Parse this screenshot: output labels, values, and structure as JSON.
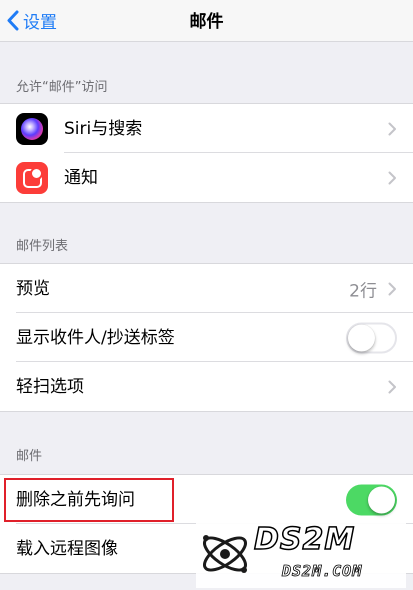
{
  "nav": {
    "back_label": "设置",
    "title": "邮件"
  },
  "sections": {
    "access": {
      "header": "允许“邮件”访问",
      "items": [
        {
          "label": "Siri与搜索",
          "icon": "siri-icon"
        },
        {
          "label": "通知",
          "icon": "notifications-icon"
        }
      ]
    },
    "list": {
      "header": "邮件列表",
      "items": [
        {
          "label": "预览",
          "value": "2行"
        },
        {
          "label": "显示收件人/抄送标签",
          "toggle": false
        },
        {
          "label": "轻扫选项"
        }
      ]
    },
    "mail": {
      "header": "邮件",
      "items": [
        {
          "label": "删除之前先询问",
          "toggle": true
        },
        {
          "label": "载入远程图像"
        }
      ]
    }
  },
  "watermark": {
    "brand": "DS2M",
    "site": "DS2M.COM"
  },
  "colors": {
    "accent": "#1f7cf6",
    "toggle_on": "#4cd964",
    "highlight": "#e0202a",
    "background": "#efeff4"
  }
}
